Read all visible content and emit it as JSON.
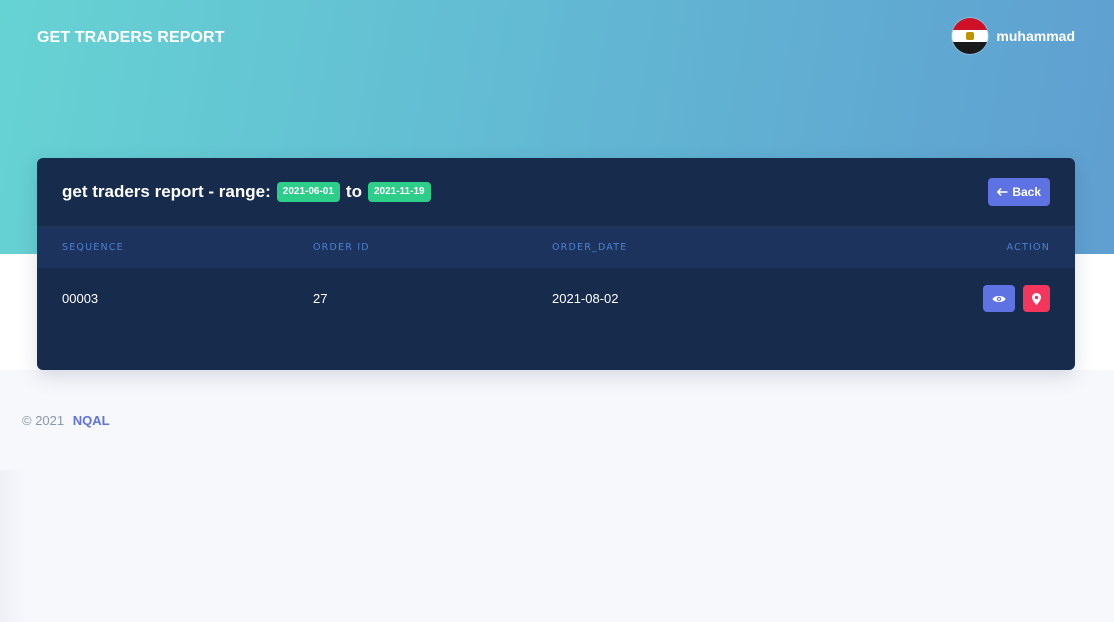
{
  "header": {
    "title": "GET TRADERS REPORT",
    "user": {
      "name": "muhammad",
      "avatar_icon": "egypt-flag-icon"
    }
  },
  "card": {
    "title_prefix": "get traders report - range:",
    "range_start": "2021-06-01",
    "range_joiner": "to",
    "range_end": "2021-11-19",
    "back_label": "Back",
    "back_icon": "arrow-left-icon"
  },
  "table": {
    "columns": [
      "SEQUENCE",
      "ORDER ID",
      "ORDER_DATE",
      "ACTION"
    ],
    "rows": [
      {
        "sequence": "00003",
        "order_id": "27",
        "order_date": "2021-08-02",
        "actions": [
          "eye-icon",
          "map-marker-icon"
        ]
      }
    ]
  },
  "footer": {
    "copyright": "© 2021",
    "brand": "NQAL"
  },
  "colors": {
    "card_bg": "#172b4d",
    "header_row_bg": "#1c345d",
    "badge": "#2dce89",
    "primary": "#5e72e4",
    "danger": "#f5365c"
  }
}
